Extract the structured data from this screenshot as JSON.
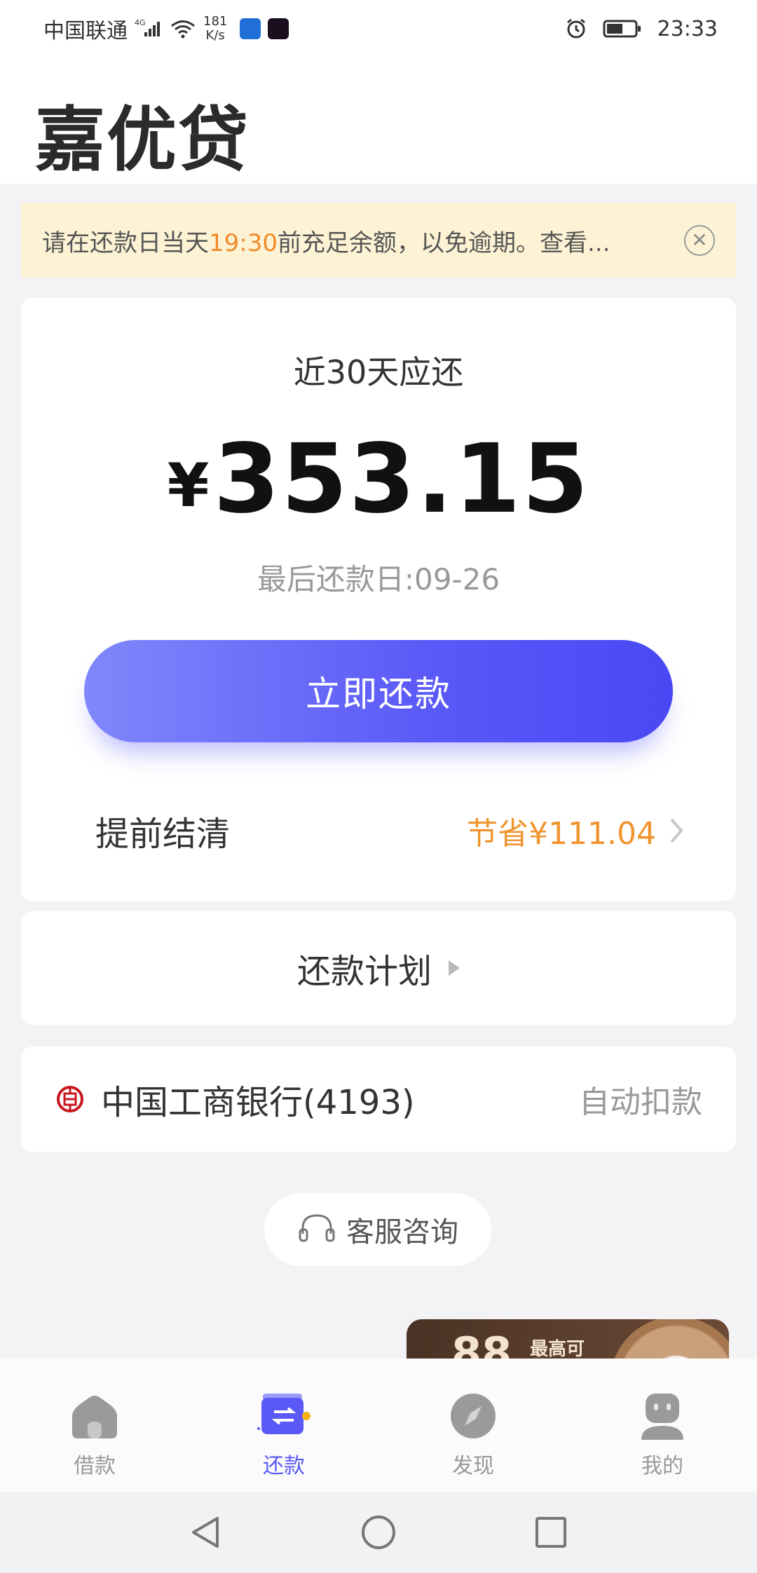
{
  "status_bar": {
    "carrier": "中国联通",
    "network": "4G",
    "speed_value": "181",
    "speed_unit": "K/s",
    "time": "23:33"
  },
  "header": {
    "title": "嘉优贷"
  },
  "notice": {
    "text_before": "请在还款日当天",
    "highlight_time": "19:30",
    "text_after": "前充足余额，以免逾期。查看...",
    "highlight_color": "#f28a2c"
  },
  "summary": {
    "due_label": "近30天应还",
    "currency": "¥",
    "amount": "353.15",
    "last_date_label": "最后还款日:09-26",
    "repay_button": "立即还款",
    "early_label": "提前结清",
    "early_save": "节省¥111.04"
  },
  "plan": {
    "label": "还款计划"
  },
  "bank": {
    "name": "中国工商银行(4193)",
    "mode": "自动扣款"
  },
  "support": {
    "label": "客服咨询"
  },
  "promo": {
    "number": "88",
    "caption": "最高可"
  },
  "tabs": [
    {
      "label": "借款",
      "icon": "house-icon",
      "active": false
    },
    {
      "label": "还款",
      "icon": "repay-card-icon",
      "active": true
    },
    {
      "label": "发现",
      "icon": "compass-icon",
      "active": false
    },
    {
      "label": "我的",
      "icon": "profile-icon",
      "active": false
    }
  ],
  "colors": {
    "accent": "#5a58f7",
    "orange": "#f0942e",
    "notice_bg": "#fdf3d4"
  }
}
